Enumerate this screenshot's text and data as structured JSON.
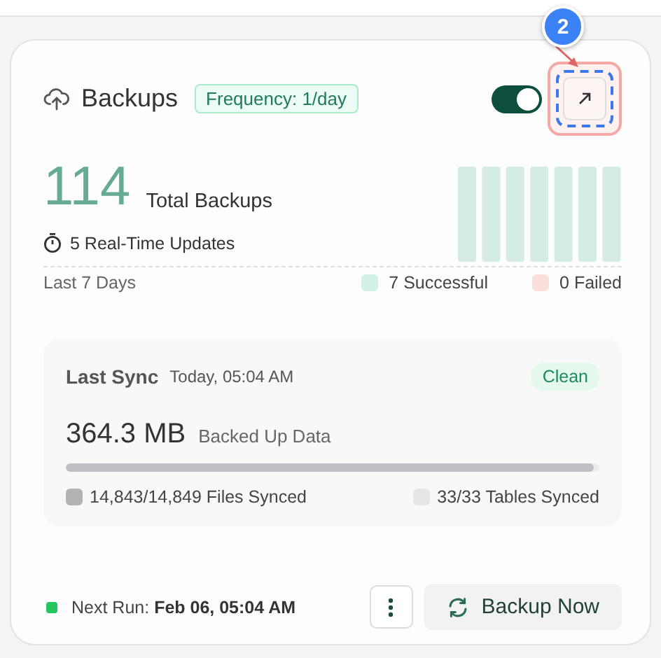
{
  "header": {
    "title": "Backups",
    "badge": "Frequency: 1/day",
    "enabled": true
  },
  "annotation": {
    "number": "2"
  },
  "stats": {
    "total": "114",
    "total_label": "Total Backups",
    "realtime": "5 Real-Time Updates",
    "period": "Last 7 Days",
    "legend": [
      {
        "label": "7 Successful",
        "color": "#d3f1e6"
      },
      {
        "label": "0 Failed",
        "color": "#fadfda"
      }
    ]
  },
  "last_sync": {
    "label": "Last Sync",
    "time": "Today, 05:04 AM",
    "status": "Clean",
    "size": "364.3 MB",
    "size_label": "Backed Up Data",
    "level": 0.99,
    "items": [
      {
        "label": "14,843/14,849 Files Synced",
        "color": "#b3b3b3"
      },
      {
        "label": "33/33 Tables Synced",
        "color": "#e6e6e6"
      }
    ]
  },
  "footer": {
    "next_run": "Next Run: **Feb 06, 05:04 AM**",
    "button": "Backup Now"
  }
}
